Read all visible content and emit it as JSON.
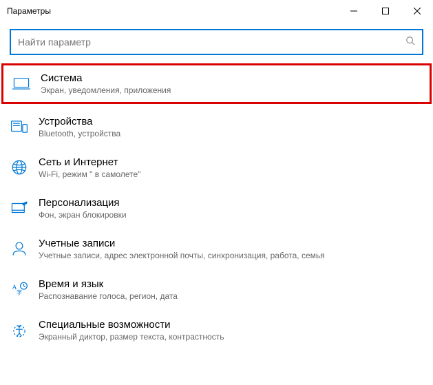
{
  "window": {
    "title": "Параметры"
  },
  "search": {
    "placeholder": "Найти параметр"
  },
  "categories": [
    {
      "title": "Система",
      "desc": "Экран, уведомления, приложения",
      "highlighted": true
    },
    {
      "title": "Устройства",
      "desc": "Bluetooth, устройства",
      "highlighted": false
    },
    {
      "title": "Сеть и Интернет",
      "desc": "Wi-Fi, режим \" в самолете\"",
      "highlighted": false
    },
    {
      "title": "Персонализация",
      "desc": "Фон, экран блокировки",
      "highlighted": false
    },
    {
      "title": "Учетные записи",
      "desc": "Учетные записи, адрес электронной почты, синхронизация, работа, семья",
      "highlighted": false
    },
    {
      "title": "Время и язык",
      "desc": "Распознавание голоса, регион, дата",
      "highlighted": false
    },
    {
      "title": "Специальные возможности",
      "desc": "Экранный диктор, размер текста, контрастность",
      "highlighted": false
    }
  ]
}
